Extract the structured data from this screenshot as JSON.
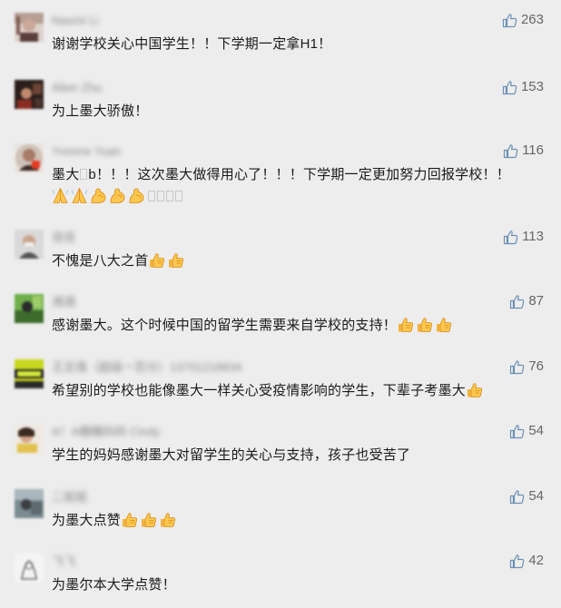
{
  "comments": [
    {
      "name": "Naomi Li",
      "likes": "263",
      "segments": [
        {
          "t": "text",
          "v": "谢谢学校关心中国学生！！下学期一定拿H1！"
        }
      ]
    },
    {
      "name": "Allen Zhu",
      "likes": "153",
      "segments": [
        {
          "t": "text",
          "v": "为上墨大骄傲！"
        }
      ]
    },
    {
      "name": "Yvonne Yuan",
      "likes": "116",
      "segments": [
        {
          "t": "text",
          "v": "墨大"
        },
        {
          "t": "box"
        },
        {
          "t": "text",
          "v": "b！！！这次墨大做得用心了！！！下学期一定更加努力回报学校！！"
        },
        {
          "t": "emoji",
          "icon": "folded-hands-emoji"
        },
        {
          "t": "emoji",
          "icon": "folded-hands-emoji"
        },
        {
          "t": "emoji",
          "icon": "flexed-biceps-emoji"
        },
        {
          "t": "emoji",
          "icon": "flexed-biceps-emoji"
        },
        {
          "t": "emoji",
          "icon": "flexed-biceps-emoji"
        },
        {
          "t": "box"
        },
        {
          "t": "box"
        },
        {
          "t": "box"
        },
        {
          "t": "box"
        }
      ]
    },
    {
      "name": "佳佳",
      "likes": "113",
      "segments": [
        {
          "t": "text",
          "v": "不愧是八大之首"
        },
        {
          "t": "emoji",
          "icon": "thumbs-up-emoji"
        },
        {
          "t": "emoji",
          "icon": "thumbs-up-emoji"
        }
      ]
    },
    {
      "name": "湘湘",
      "likes": "87",
      "segments": [
        {
          "t": "text",
          "v": "感谢墨大。这个时候中国的留学生需要来自学校的支持！"
        },
        {
          "t": "emoji",
          "icon": "thumbs-up-emoji"
        },
        {
          "t": "emoji",
          "icon": "thumbs-up-emoji"
        },
        {
          "t": "emoji",
          "icon": "thumbs-up-emoji"
        }
      ]
    },
    {
      "name": "王志强（超级一百分）13701218834",
      "likes": "76",
      "segments": [
        {
          "t": "text",
          "v": "希望别的学校也能像墨大一样关心受疫情影响的学生，下辈子考墨大"
        },
        {
          "t": "emoji",
          "icon": "thumbs-up-emoji"
        }
      ]
    },
    {
      "name": "A！A糖糖妈妈 Cindy",
      "likes": "54",
      "segments": [
        {
          "t": "text",
          "v": "学生的妈妈感谢墨大对留学生的关心与支持，孩子也受苦了"
        }
      ]
    },
    {
      "name": "二姐姐",
      "likes": "54",
      "segments": [
        {
          "t": "text",
          "v": "为墨大点赞"
        },
        {
          "t": "emoji",
          "icon": "thumbs-up-emoji"
        },
        {
          "t": "emoji",
          "icon": "thumbs-up-emoji"
        },
        {
          "t": "emoji",
          "icon": "thumbs-up-emoji"
        }
      ]
    },
    {
      "name": "飞飞",
      "likes": "42",
      "segments": [
        {
          "t": "text",
          "v": "为墨尔本大学点赞！"
        }
      ]
    }
  ],
  "colors": {
    "background": "#ededed",
    "text": "#1a1a1a",
    "like_icon": "#6b8fb5",
    "like_count": "#666666",
    "name": "#888888"
  }
}
